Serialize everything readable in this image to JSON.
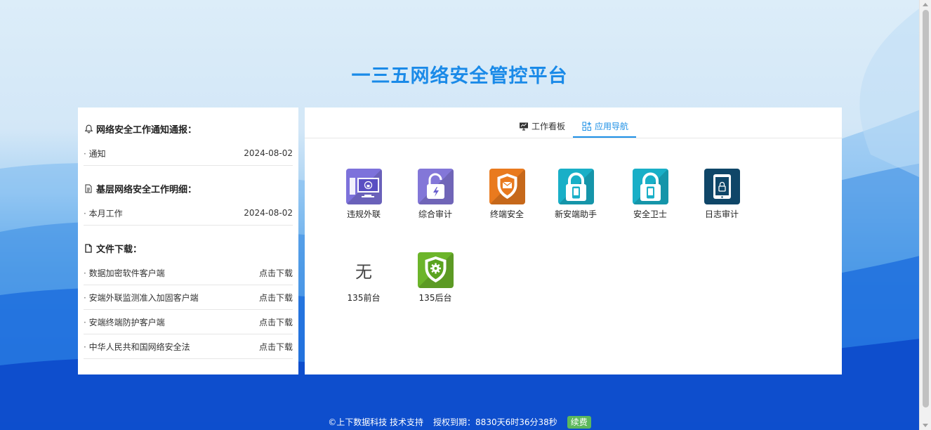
{
  "page": {
    "title": "一三五网络安全管控平台"
  },
  "left": {
    "sections": [
      {
        "icon": "bell-icon",
        "title": "网络安全工作通知通报：",
        "rows": [
          {
            "name": "通知",
            "value": "2024-08-02"
          }
        ]
      },
      {
        "icon": "document-icon",
        "title": "基层网络安全工作明细：",
        "rows": [
          {
            "name": "本月工作",
            "value": "2024-08-02"
          }
        ]
      },
      {
        "icon": "file-icon",
        "title": "文件下载：",
        "rows": [
          {
            "name": "数据加密软件客户端",
            "value": "点击下载"
          },
          {
            "name": "安端外联监测准入加固客户端",
            "value": "点击下载"
          },
          {
            "name": "安端终端防护客户端",
            "value": "点击下载"
          },
          {
            "name": "中华人民共和国网络安全法",
            "value": "点击下载"
          }
        ]
      }
    ]
  },
  "right": {
    "tabs": [
      {
        "label": "工作看板",
        "icon": "monitor-icon",
        "active": false
      },
      {
        "label": "应用导航",
        "icon": "apps-icon",
        "active": true
      }
    ],
    "apps": [
      {
        "label": "违规外联",
        "icon": "computer-lock-icon",
        "color": "#7b6fd9"
      },
      {
        "label": "综合审计",
        "icon": "unlock-bolt-icon",
        "color": "#7f74d6"
      },
      {
        "label": "终端安全",
        "icon": "shield-mail-icon",
        "color": "#e8791f"
      },
      {
        "label": "新安端助手",
        "icon": "lock-phone-icon",
        "color": "#17aec6"
      },
      {
        "label": "安全卫士",
        "icon": "lock-phone-icon",
        "color": "#17aec6"
      },
      {
        "label": "日志审计",
        "icon": "tablet-lock-icon",
        "color": "#0e4566"
      },
      {
        "label": "135前台",
        "icon_text": "无"
      },
      {
        "label": "135后台",
        "icon": "shield-gear-icon",
        "color": "#6db52b"
      }
    ]
  },
  "footer": {
    "support": "©上下数据科技 技术支持",
    "license": "授权到期：8830天6时36分38秒",
    "renew": "续费"
  }
}
